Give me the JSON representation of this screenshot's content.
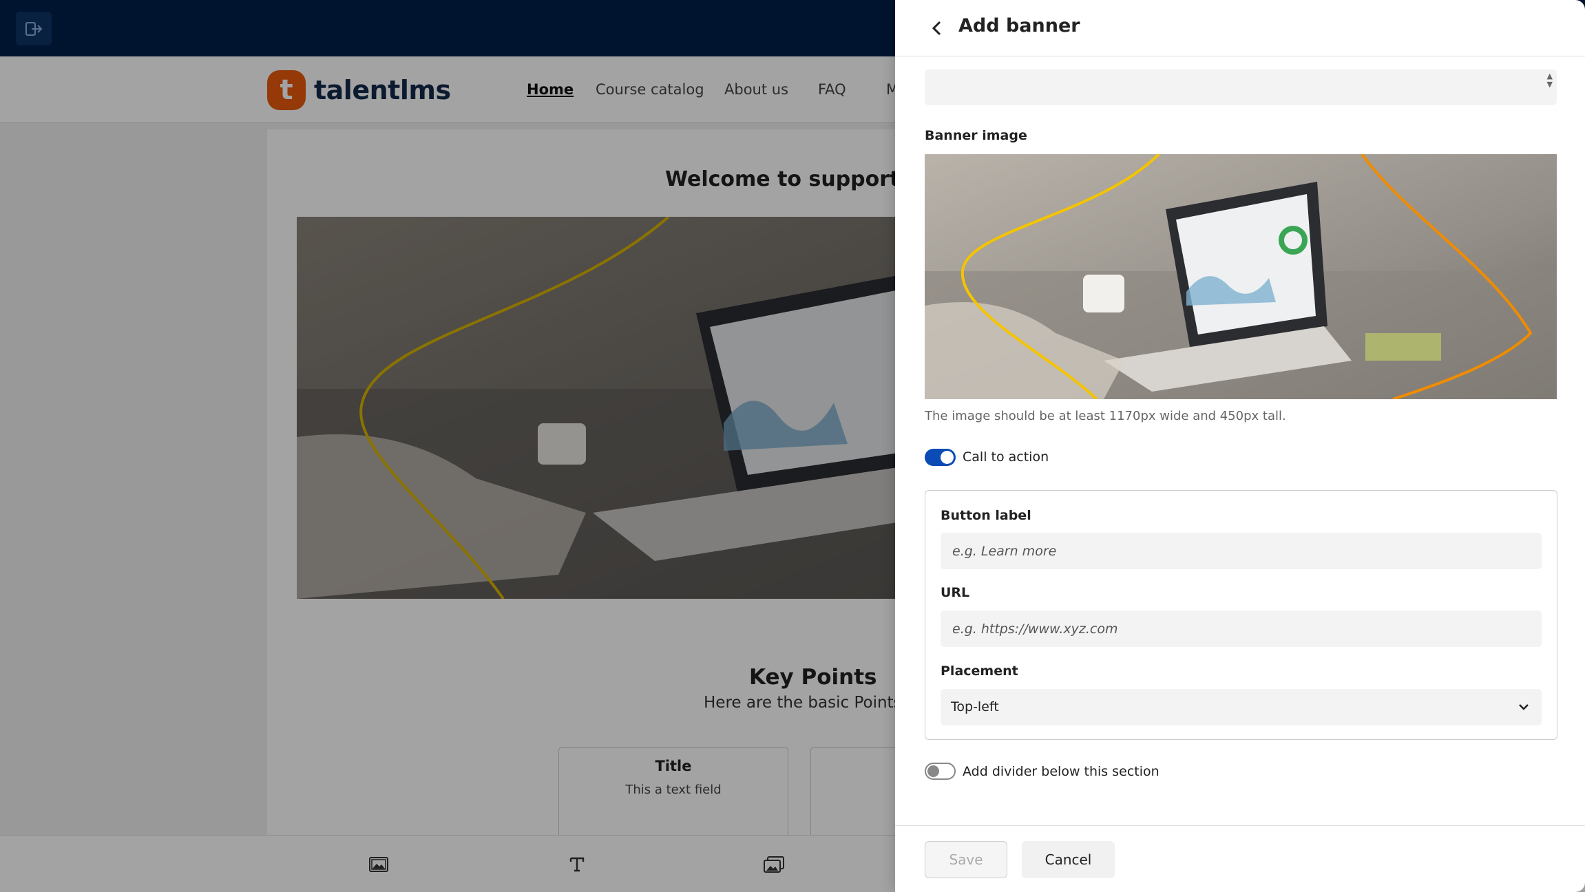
{
  "site": {
    "logo_mark": "t",
    "logo_text": "talentlms",
    "nav": [
      "Home",
      "Course catalog",
      "About us",
      "FAQ",
      "M"
    ],
    "welcome": "Welcome to supporther",
    "key_title": "Key Points",
    "key_sub": "Here are the basic Points",
    "cards": [
      {
        "title": "Title",
        "text": "This a text field"
      },
      {
        "title": "",
        "text": ""
      }
    ]
  },
  "drawer": {
    "title": "Add banner",
    "banner_image_label": "Banner image",
    "hint": "The image should be at least 1170px wide and 450px tall.",
    "cta_toggle_label": "Call to action",
    "cta_enabled": true,
    "button_label_label": "Button label",
    "button_label_placeholder": "e.g. Learn more",
    "url_label": "URL",
    "url_placeholder": "e.g. https://www.xyz.com",
    "placement_label": "Placement",
    "placement_value": "Top-left",
    "divider_toggle_label": "Add divider below this section",
    "divider_enabled": false,
    "save_label": "Save",
    "cancel_label": "Cancel"
  },
  "icons": [
    "exit-editor-icon",
    "back-arrow-icon",
    "image-tool-icon",
    "text-tool-icon",
    "gallery-tool-icon",
    "chevron-down-icon"
  ],
  "colors": {
    "topbar": "#01204a",
    "accent": "#0a4bb5",
    "brand": "#e8590c"
  }
}
